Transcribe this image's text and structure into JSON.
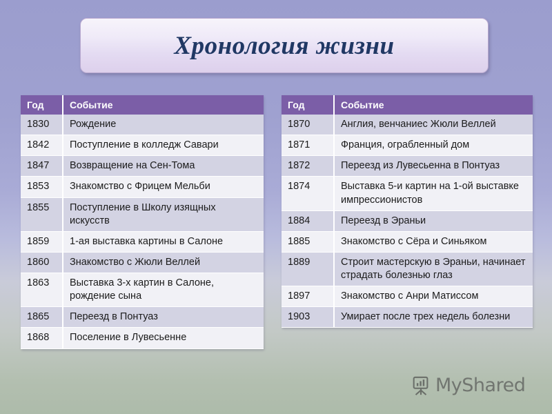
{
  "slide": {
    "title": "Хронология жизни"
  },
  "tables": [
    {
      "id": "timeline-table-left",
      "columns": [
        "Год",
        "Событие"
      ],
      "rows": [
        {
          "year": "1830",
          "event": "Рождение"
        },
        {
          "year": "1842",
          "event": "Поступление в колледж Савари"
        },
        {
          "year": "1847",
          "event": "Возвращение на Сен-Тома"
        },
        {
          "year": "1853",
          "event": "Знакомство с Фрицем Мельби"
        },
        {
          "year": "1855",
          "event": "Поступление в Школу изящных искусств"
        },
        {
          "year": "1859",
          "event": "1-ая выставка картины в Салоне"
        },
        {
          "year": "1860",
          "event": "Знакомство с Жюли Веллей"
        },
        {
          "year": "1863",
          "event": "Выставка 3-х картин в Салоне, рождение сына"
        },
        {
          "year": "1865",
          "event": "Переезд в Понтуаз"
        },
        {
          "year": "1868",
          "event": "Поселение в Лувесьенне"
        }
      ]
    },
    {
      "id": "timeline-table-right",
      "columns": [
        "Год",
        "Событие"
      ],
      "rows": [
        {
          "year": "1870",
          "event": "Англия, венчаниес Жюли Веллей"
        },
        {
          "year": "1871",
          "event": "Франция, ограбленный дом"
        },
        {
          "year": "1872",
          "event": "Переезд из Лувесьенна в Понтуаз"
        },
        {
          "year": "1874",
          "event": "Выставка 5-и картин на 1-ой выставке импрессионистов"
        },
        {
          "year": "1884",
          "event": "Переезд в Эраньи"
        },
        {
          "year": "1885",
          "event": "Знакомство с Сёра и Синьяком"
        },
        {
          "year": "1889",
          "event": "Строит мастерскую в Эраньи, начинает страдать болезнью глаз"
        },
        {
          "year": "1897",
          "event": "Знакомство с Анри Матиссом"
        },
        {
          "year": "1903",
          "event": "Умирает после трех недель болезни"
        }
      ]
    }
  ],
  "watermark": {
    "label": "MyShared",
    "icon": "presentation-chart-icon"
  },
  "colors": {
    "header_purple": "#7b5ea7",
    "row_shaded": "#d3d3e3",
    "row_plain": "#f1f1f6",
    "title_text": "#203864",
    "background_top": "#9b9dce",
    "background_bottom": "#adbbaa"
  }
}
